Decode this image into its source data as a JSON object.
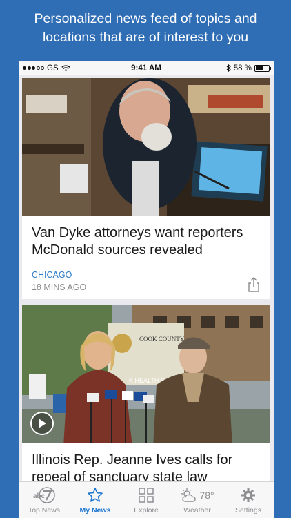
{
  "promo": {
    "line1": "Personalized news feed of topics and",
    "line2": "locations that are of interest to you"
  },
  "status_bar": {
    "carrier": "GS",
    "time": "9:41 AM",
    "battery": "58 %",
    "battery_level": 0.58
  },
  "feed": {
    "articles": [
      {
        "headline": "Van Dyke attorneys want reporters McDonald sources revealed",
        "category": "CHICAGO",
        "time": "18 MINS AGO"
      },
      {
        "headline": "Illinois Rep. Jeanne Ives calls for repeal of sanctuary state law",
        "sign_text_1": "COOK COUNTY",
        "sign_text_2": "K HEALTH S"
      }
    ]
  },
  "tabbar": {
    "tabs": [
      {
        "label": "Top News",
        "icon": "abc7-logo-icon"
      },
      {
        "label": "My News",
        "icon": "star-icon"
      },
      {
        "label": "Explore",
        "icon": "grid-icon"
      },
      {
        "label": "Weather",
        "icon": "sun-cloud-icon",
        "temp": "78°"
      },
      {
        "label": "Settings",
        "icon": "gear-icon"
      }
    ]
  },
  "colors": {
    "background": "#2f6db5",
    "accent": "#1f77d0",
    "category": "#2d7ac6"
  }
}
